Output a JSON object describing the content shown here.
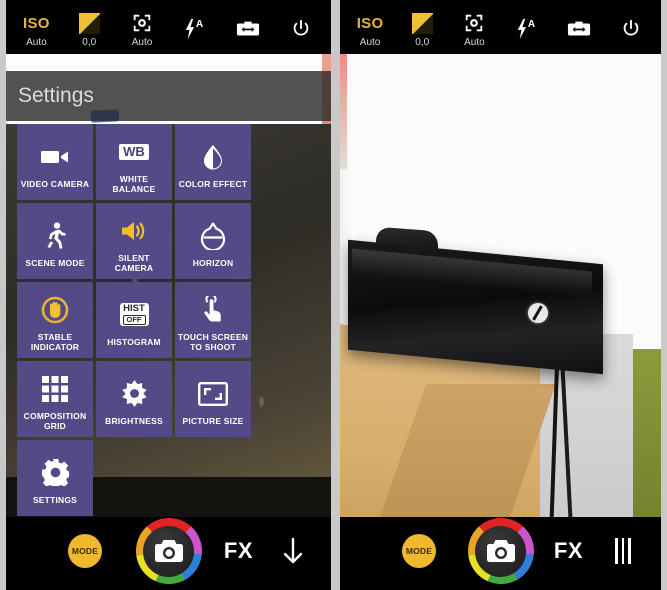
{
  "toolbar": {
    "items": [
      {
        "name": "iso",
        "glyph": "ISO",
        "label": "Auto"
      },
      {
        "name": "exposure-compensation",
        "glyph": "+",
        "label": "0,0"
      },
      {
        "name": "focus",
        "glyph": "focus",
        "label": "Auto"
      },
      {
        "name": "flash",
        "glyph": "flash-auto",
        "label": ""
      },
      {
        "name": "switch-camera",
        "glyph": "switch",
        "label": ""
      },
      {
        "name": "power",
        "glyph": "power",
        "label": ""
      }
    ]
  },
  "settings": {
    "title": "Settings",
    "tiles": [
      {
        "label": "VIDEO CAMERA",
        "icon": "video-camera-icon"
      },
      {
        "label": "WHITE BALANCE",
        "icon": "white-balance-icon",
        "badge": "WB"
      },
      {
        "label": "COLOR EFFECT",
        "icon": "color-effect-icon"
      },
      {
        "label": "SCENE MODE",
        "icon": "scene-mode-icon"
      },
      {
        "label": "SILENT CAMERA",
        "icon": "silent-camera-icon"
      },
      {
        "label": "HORIZON",
        "icon": "horizon-icon"
      },
      {
        "label": "STABLE INDICATOR",
        "icon": "stable-indicator-icon"
      },
      {
        "label": "HISTOGRAM",
        "icon": "histogram-icon",
        "badge_top": "HIST",
        "badge_bottom": "OFF"
      },
      {
        "label": "TOUCH SCREEN TO SHOOT",
        "icon": "touch-screen-icon"
      },
      {
        "label": "COMPOSITION GRID",
        "icon": "composition-grid-icon"
      },
      {
        "label": "BRIGHTNESS",
        "icon": "brightness-icon"
      },
      {
        "label": "PICTURE SIZE",
        "icon": "picture-size-icon"
      },
      {
        "label": "SETTINGS",
        "icon": "gear-icon"
      }
    ]
  },
  "bottombar": {
    "mode_label": "MODE",
    "fx_label": "FX",
    "left_last_icon": "arrow-down-icon",
    "right_last_icon": "three-bars-icon"
  },
  "colors": {
    "tile_purple": "#544a87",
    "accent_yellow": "#f0b82c",
    "iso_yellow": "#e8b43a",
    "bar_black": "#000000",
    "frame_gray": "#c9c9c9"
  }
}
